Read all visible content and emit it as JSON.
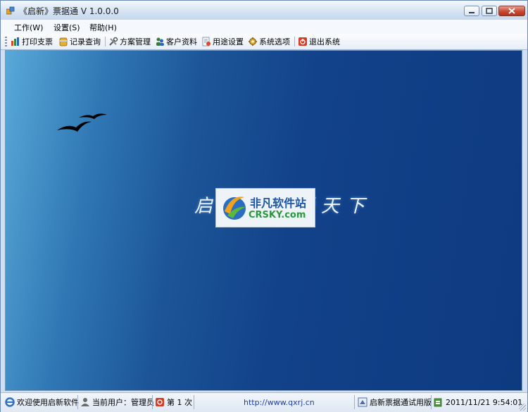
{
  "window": {
    "title": "《启新》票据通 V 1.0.0.0"
  },
  "menu": {
    "items": [
      "工作(W)",
      "设置(S)",
      "帮助(H)"
    ]
  },
  "toolbar": {
    "items": [
      "打印支票",
      "记录查询",
      "方案管理",
      "客户资料",
      "用途设置",
      "系统选项",
      "退出系统"
    ]
  },
  "main": {
    "slogan": "启新票据通天下",
    "watermark": {
      "cn": "非凡软件站",
      "en": "CRSKY.com"
    }
  },
  "status": {
    "welcome": "欢迎使用启新软件",
    "user": "当前用户：管理员",
    "count": "第 1 次",
    "url": "http://www.qxrj.cn",
    "edition": "启新票据通试用版",
    "datetime": "2011/11/21 9:54:01"
  },
  "colors": {
    "titlebar": "#d6e4f3",
    "desktop": "#12428a",
    "close_button": "#c84a33"
  }
}
